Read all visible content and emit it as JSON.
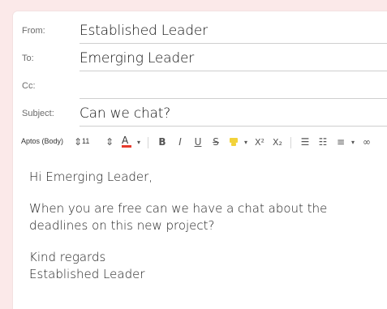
{
  "fields": {
    "from": {
      "label": "From:",
      "value": "Established Leader"
    },
    "to": {
      "label": "To:",
      "value": "Emerging Leader"
    },
    "cc": {
      "label": "Cc:",
      "value": ""
    },
    "subject": {
      "label": "Subject:",
      "value": "Can we chat?"
    }
  },
  "toolbar": {
    "font_name": "Aptos (Body)",
    "font_size": "11",
    "icons": {
      "font_color": "font-color-icon",
      "bold": "bold-icon",
      "italic": "italic-icon",
      "underline": "underline-icon",
      "strikethrough": "strikethrough-icon",
      "highlight": "highlight-icon",
      "superscript": "superscript-icon",
      "subscript": "subscript-icon",
      "bulleted_list": "bulleted-list-icon",
      "numbered_list": "numbered-list-icon",
      "align": "align-icon"
    }
  },
  "body": {
    "greeting": "Hi Emerging Leader,",
    "message": "When you are free can we have a chat about the deadlines on this new project?",
    "closing": "Kind regards",
    "signature": "Established Leader"
  },
  "colors": {
    "background": "#fbe9e9",
    "font_color_bar": "#e63b2e",
    "highlight_color": "#f2d23a"
  }
}
